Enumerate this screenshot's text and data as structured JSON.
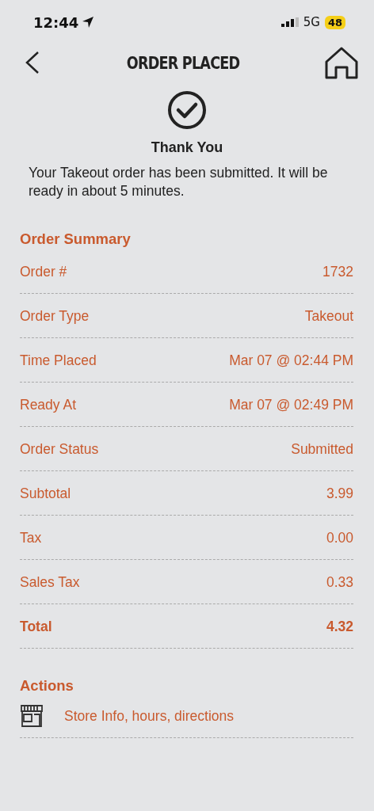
{
  "status_bar": {
    "time": "12:44",
    "network": "5G",
    "battery": "48"
  },
  "header": {
    "title": "ORDER PLACED"
  },
  "confirmation": {
    "title": "Thank You",
    "message": "Your Takeout order has been submitted. It will be ready in about 5 minutes."
  },
  "order_summary": {
    "title": "Order Summary",
    "rows": [
      {
        "kind": "line",
        "label": "Order #",
        "value": "1732"
      },
      {
        "kind": "line",
        "label": "Order Type",
        "value": "Takeout"
      },
      {
        "kind": "line",
        "label": "Time Placed",
        "value": "Mar 07 @ 02:44 PM"
      },
      {
        "kind": "line",
        "label": "Ready At",
        "value": "Mar 07 @ 02:49 PM"
      },
      {
        "kind": "line",
        "label": "Order Status",
        "value": "Submitted"
      },
      {
        "kind": "line",
        "label": "Subtotal",
        "value": "3.99"
      },
      {
        "kind": "line",
        "label": "Tax",
        "value": "0.00"
      },
      {
        "kind": "line",
        "label": "Sales Tax",
        "value": "0.33"
      },
      {
        "kind": "total",
        "label": "Total",
        "value": "4.32"
      }
    ]
  },
  "actions": {
    "title": "Actions",
    "items": [
      {
        "label": "Store Info, hours, directions"
      }
    ]
  }
}
